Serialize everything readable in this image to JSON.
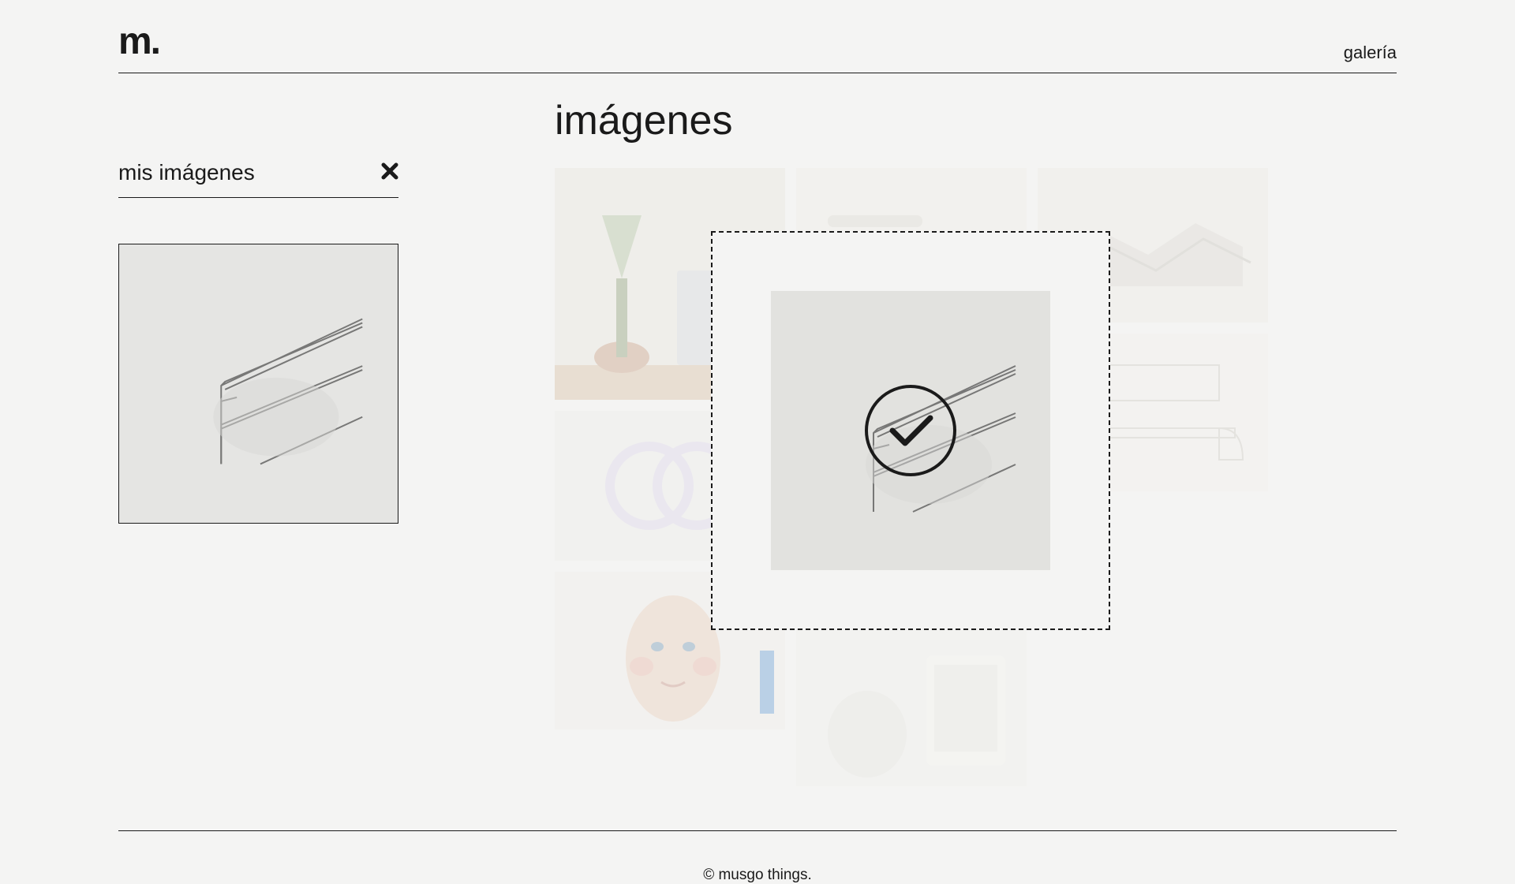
{
  "header": {
    "logo": "m.",
    "nav_link": "galería"
  },
  "sidebar": {
    "title": "mis imágenes",
    "close_icon": "close-icon"
  },
  "gallery": {
    "title": "imágenes"
  },
  "dropzone": {
    "status_icon": "checkmark-circle-icon"
  },
  "footer": {
    "copyright": "© musgo things."
  }
}
